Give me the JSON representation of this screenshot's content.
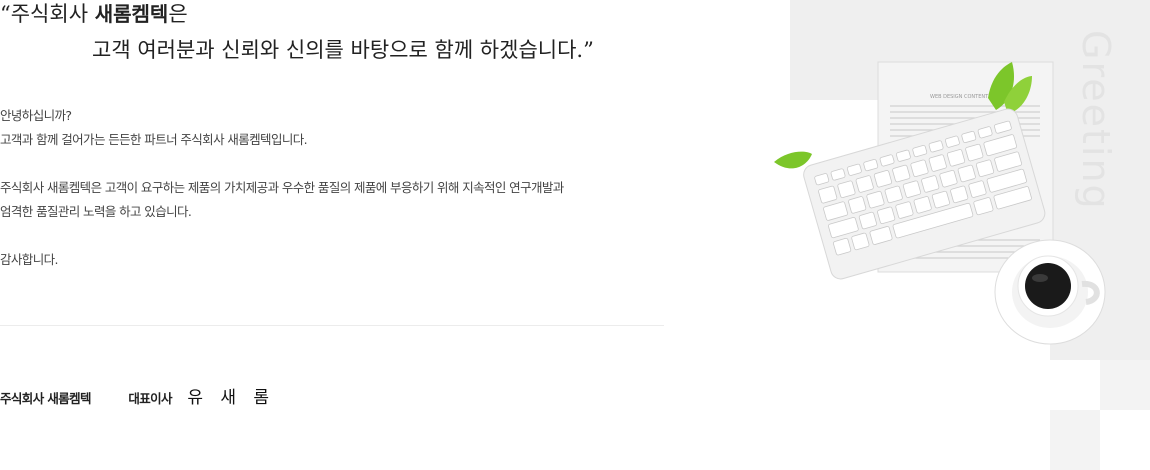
{
  "quote": {
    "line1_prefix": "“주식회사 ",
    "company_bold": "새롬켐텍",
    "line1_suffix": "은",
    "line2": "고객 여러분과 신뢰와 신의를 바탕으로 함께 하겠습니다.”"
  },
  "body": {
    "p1": "안녕하십니까?",
    "p2": "고객과 함께 걸어가는 든든한 파트너 주식회사 새롬켐텍입니다.",
    "p3": "주식회사 새롬켐텍은 고객이 요구하는 제품의 가치제공과 우수한 품질의 제품에 부응하기 위해 지속적인 연구개발과",
    "p4": "엄격한 품질관리 노력을 하고 있습니다.",
    "p5": "감사합니다."
  },
  "signature": {
    "company": "주식회사 새롬켐텍",
    "role": "대표이사",
    "name": "유 새 롬"
  },
  "visual": {
    "side_title": "Greeting",
    "newspaper_caption": "WEB DESIGN CONTENT",
    "colors": {
      "panel": "#efefef",
      "side_title": "#e3e3e3",
      "leaf": "#7cc62a",
      "coffee": "#1a1a1a"
    },
    "icons": [
      "keyboard-icon",
      "newspaper-icon",
      "coffee-cup-icon",
      "leaf-icon"
    ]
  }
}
